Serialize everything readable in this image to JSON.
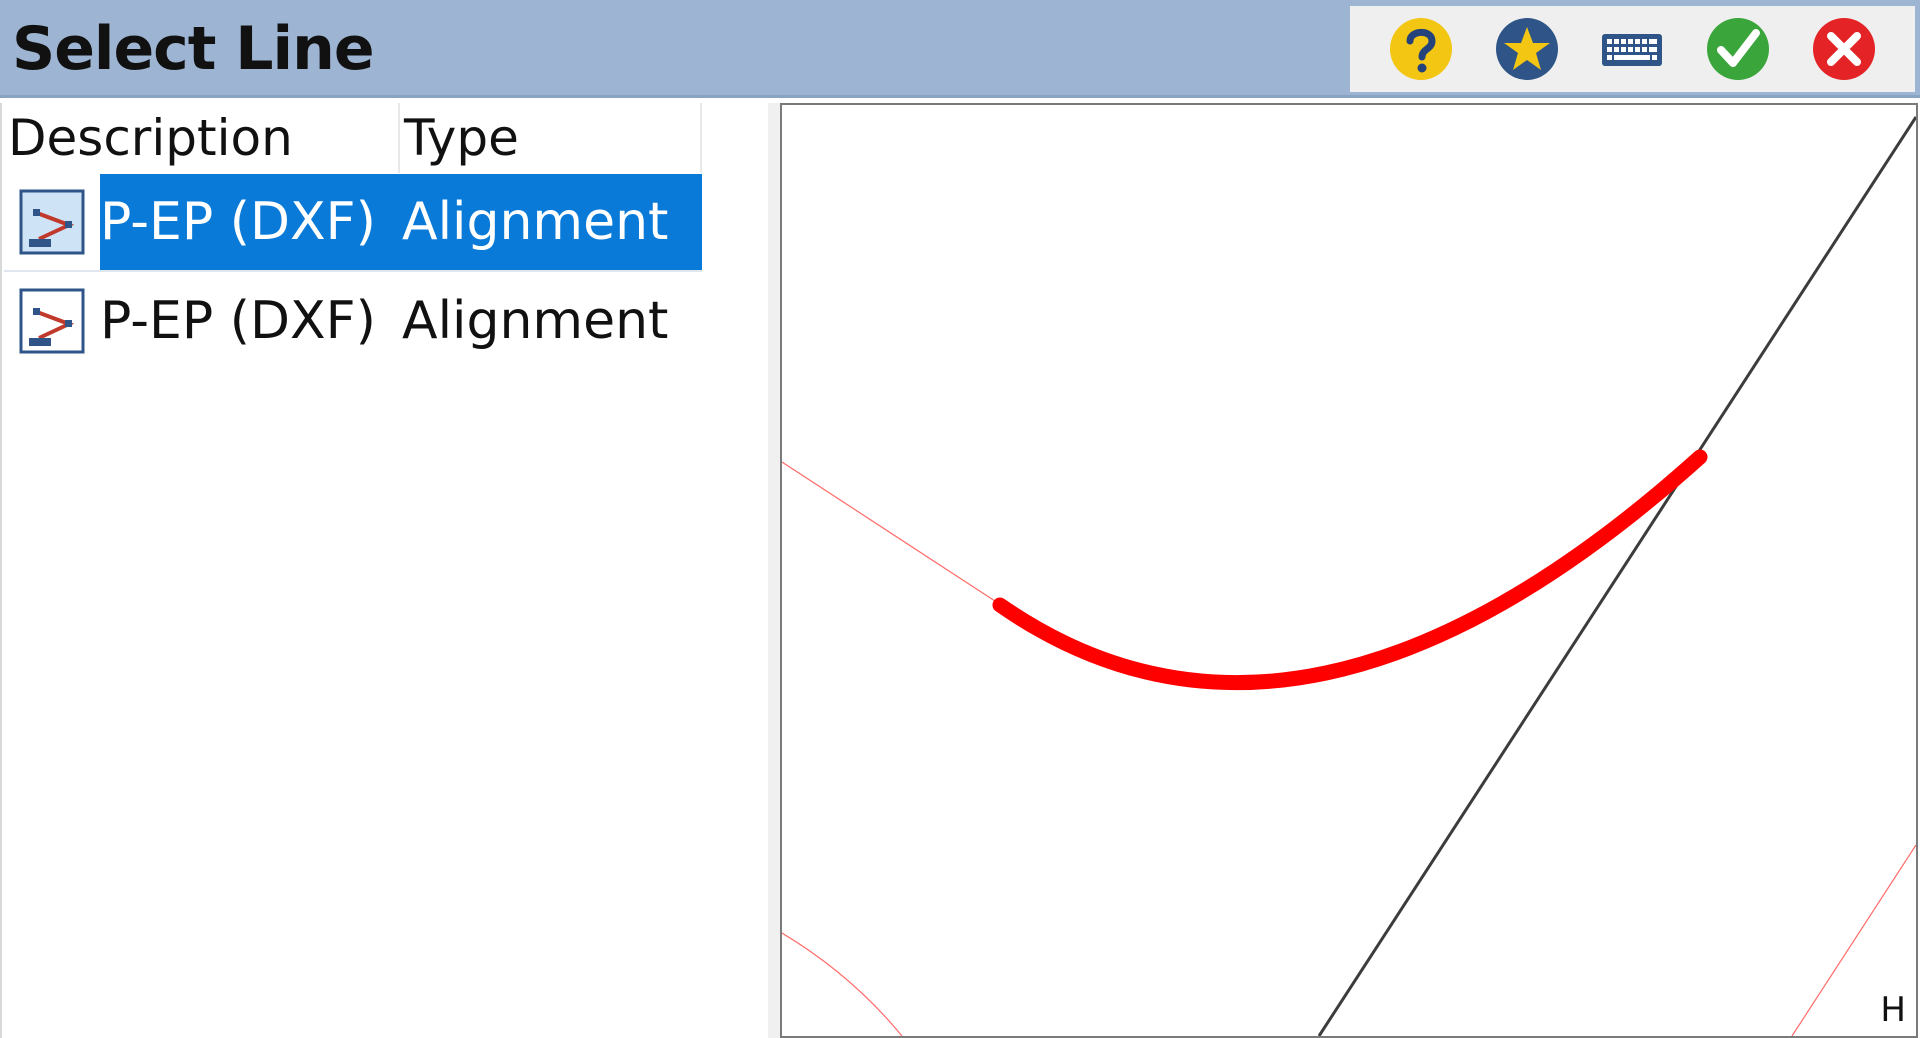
{
  "window": {
    "title": "Select Line"
  },
  "toolbar": {
    "buttons": [
      {
        "name": "help",
        "icon": "question-icon",
        "color": "#f3c613"
      },
      {
        "name": "favorites",
        "icon": "star-icon",
        "color": "#2f5487"
      },
      {
        "name": "keyboard",
        "icon": "keyboard-icon",
        "color": "#2f5487"
      },
      {
        "name": "accept",
        "icon": "check-icon",
        "color": "#3aa53a"
      },
      {
        "name": "cancel",
        "icon": "close-icon",
        "color": "#e42326"
      }
    ]
  },
  "list": {
    "columns": {
      "description": "Description",
      "type": "Type"
    },
    "rows": [
      {
        "description": "P-EP (DXF)",
        "type": "Alignment",
        "icon": "alignment-icon",
        "selected": true
      },
      {
        "description": "P-EP (DXF)",
        "type": "Alignment",
        "icon": "alignment-icon",
        "selected": false
      }
    ]
  },
  "map": {
    "corner_label": "H",
    "colors": {
      "selected_line": "#ff0000",
      "other_line": "#ff6a6a",
      "reference_line": "#3c3c3c"
    }
  },
  "colors": {
    "titlebar": "#9db5d3",
    "selection": "#0a7ad9"
  }
}
